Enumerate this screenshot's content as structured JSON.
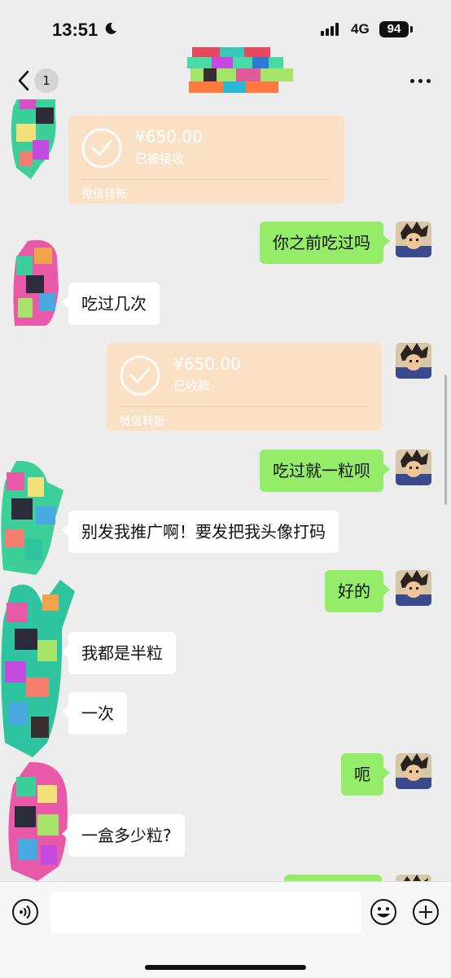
{
  "status_bar": {
    "time": "13:51",
    "network": "4G",
    "battery": "94"
  },
  "nav": {
    "unread_count": "1"
  },
  "messages": {
    "t1_amount": "¥650.00",
    "t1_status": "已被接收",
    "t1_label": "微信转账",
    "m1": "你之前吃过吗",
    "m2": "吃过几次",
    "t2_amount": "¥650.00",
    "t2_status": "已收款",
    "t2_label": "微信转账",
    "m3": "吃过就一粒呗",
    "m4": "别发我推广啊！要发把我头像打码",
    "m5": "好的",
    "m6": "我都是半粒",
    "m7": "一次",
    "m8": "呃",
    "m9": "一盒多少粒?"
  },
  "colors": {
    "background": "#ededed",
    "outgoing_bubble": "#95ec69",
    "incoming_bubble": "#ffffff",
    "transfer_card": "#fae1c6"
  },
  "icons": [
    "back-chevron-icon",
    "more-icon",
    "voice-icon",
    "emoji-icon",
    "plus-icon",
    "check-circle-icon"
  ]
}
